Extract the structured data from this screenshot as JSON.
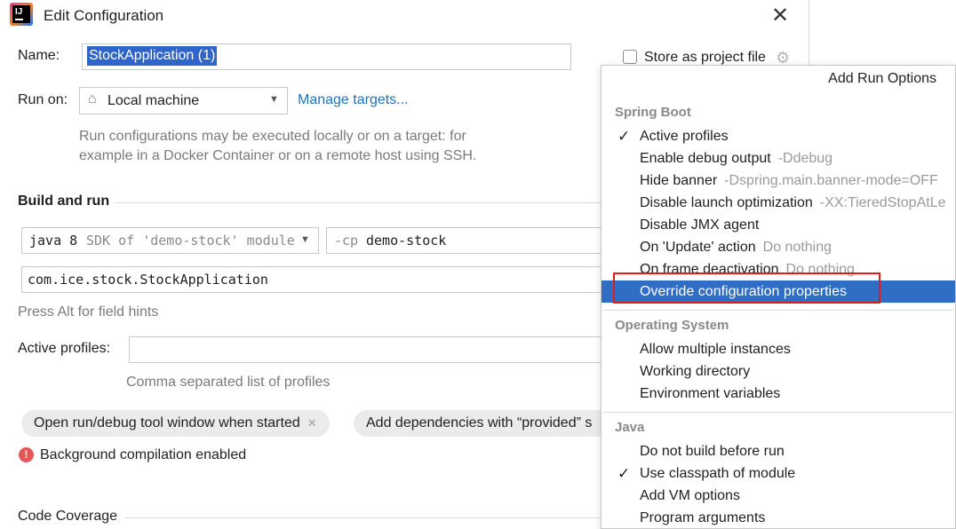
{
  "title": "Edit Configuration",
  "name_label": "Name:",
  "name_value": "StockApplication (1)",
  "store_label": "Store as project file",
  "run_on_label": "Run on:",
  "run_on_value": "Local machine",
  "manage_targets": "Manage targets...",
  "run_on_hint_1": "Run configurations may be executed locally or on a target: for",
  "run_on_hint_2": "example in a Docker Container or on a remote host using SSH.",
  "build_and_run": "Build and run",
  "jdk_main": "java 8",
  "jdk_detail": "SDK of 'demo-stock' module",
  "cp_prefix": "-cp",
  "cp_value": "demo-stock",
  "main_class": "com.ice.stock.StockApplication",
  "field_hints": "Press Alt for field hints",
  "active_profiles_label": "Active profiles:",
  "active_profiles_hint": "Comma separated list of profiles",
  "tag_1": "Open run/debug tool window when started",
  "tag_2": "Add dependencies with “provided” s",
  "bg_compilation": "Background compilation enabled",
  "code_coverage": "Code Coverage",
  "popup": {
    "title": "Add Run Options",
    "groups": [
      {
        "name": "Spring Boot",
        "items": [
          {
            "label": "Active profiles",
            "hint": "",
            "checked": true
          },
          {
            "label": "Enable debug output",
            "hint": "-Ddebug",
            "checked": false
          },
          {
            "label": "Hide banner",
            "hint": "-Dspring.main.banner-mode=OFF",
            "checked": false
          },
          {
            "label": "Disable launch optimization",
            "hint": "-XX:TieredStopAtLe",
            "checked": false
          },
          {
            "label": "Disable JMX agent",
            "hint": "",
            "checked": false
          },
          {
            "label": "On 'Update' action",
            "hint": "Do nothing",
            "checked": false
          },
          {
            "label": "On frame deactivation",
            "hint": "Do nothing",
            "checked": false
          },
          {
            "label": "Override configuration properties",
            "hint": "",
            "checked": false,
            "selected": true
          }
        ]
      },
      {
        "name": "Operating System",
        "items": [
          {
            "label": "Allow multiple instances",
            "hint": "",
            "checked": false
          },
          {
            "label": "Working directory",
            "hint": "",
            "checked": false
          },
          {
            "label": "Environment variables",
            "hint": "",
            "checked": false
          }
        ]
      },
      {
        "name": "Java",
        "items": [
          {
            "label": "Do not build before run",
            "hint": "",
            "checked": false
          },
          {
            "label": "Use classpath of module",
            "hint": "",
            "checked": true
          },
          {
            "label": "Add VM options",
            "hint": "",
            "checked": false
          },
          {
            "label": "Program arguments",
            "hint": "",
            "checked": false
          }
        ]
      }
    ]
  }
}
